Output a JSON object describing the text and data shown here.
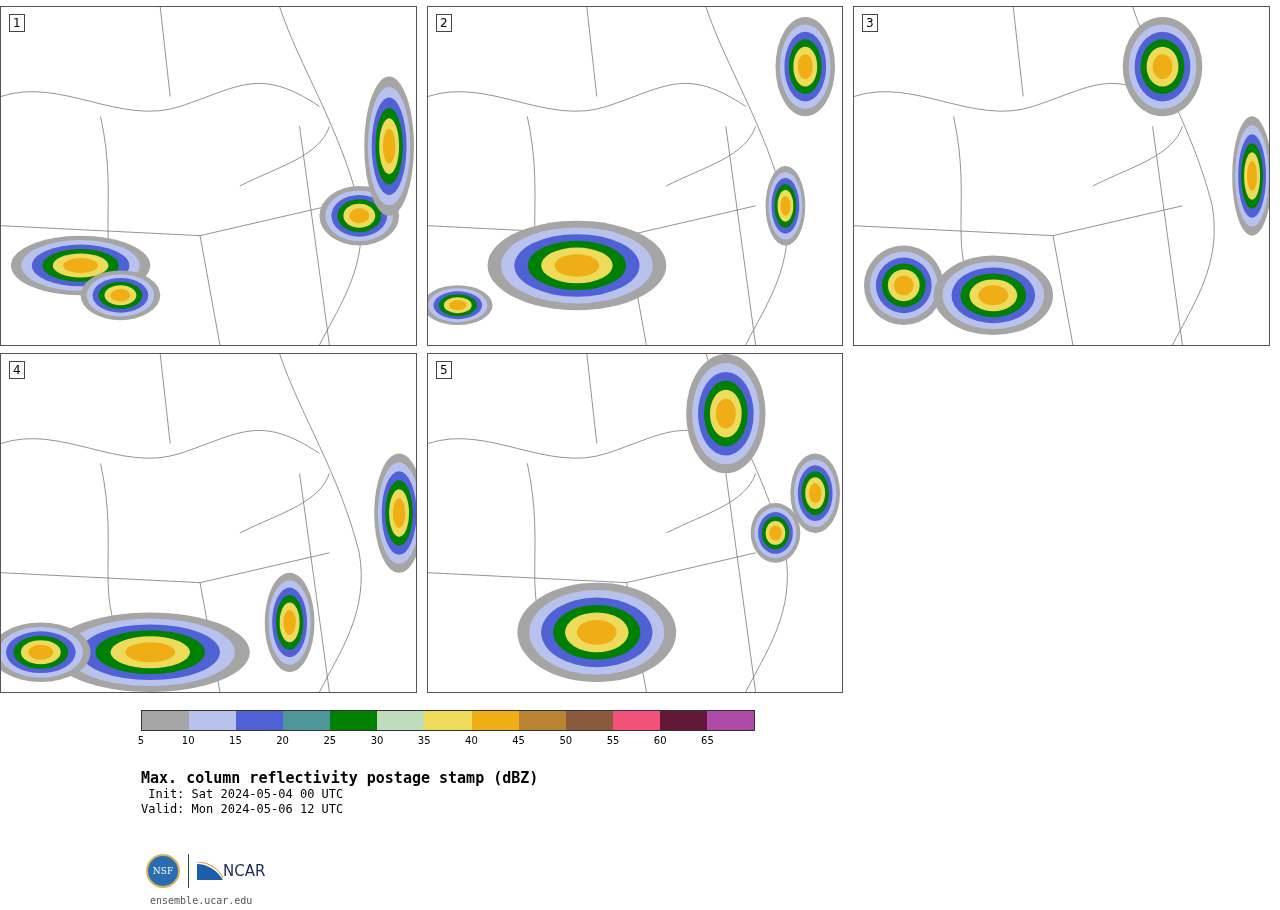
{
  "panels": [
    {
      "label": "1"
    },
    {
      "label": "2"
    },
    {
      "label": "3"
    },
    {
      "label": "4"
    },
    {
      "label": "5"
    }
  ],
  "colorbar": {
    "segments": [
      {
        "tick": "5",
        "color": "#a5a5a5"
      },
      {
        "tick": "10",
        "color": "#b8c2ec"
      },
      {
        "tick": "15",
        "color": "#5060d5"
      },
      {
        "tick": "20",
        "color": "#4f969a"
      },
      {
        "tick": "25",
        "color": "#008000"
      },
      {
        "tick": "30",
        "color": "#bfdcbc"
      },
      {
        "tick": "35",
        "color": "#eedb5b"
      },
      {
        "tick": "40",
        "color": "#efae16"
      },
      {
        "tick": "45",
        "color": "#ba8331"
      },
      {
        "tick": "50",
        "color": "#8b5a3c"
      },
      {
        "tick": "55",
        "color": "#f2527a"
      },
      {
        "tick": "60",
        "color": "#621836"
      },
      {
        "tick": "65",
        "color": "#ae4aa7"
      }
    ]
  },
  "title": "Max. column reflectivity postage stamp (dBZ)",
  "init": " Init: Sat 2024-05-04 00 UTC",
  "valid": "Valid: Mon 2024-05-06 12 UTC",
  "logo": {
    "seal": "NSF",
    "name": "NCAR"
  },
  "url": "ensemble.ucar.edu"
}
